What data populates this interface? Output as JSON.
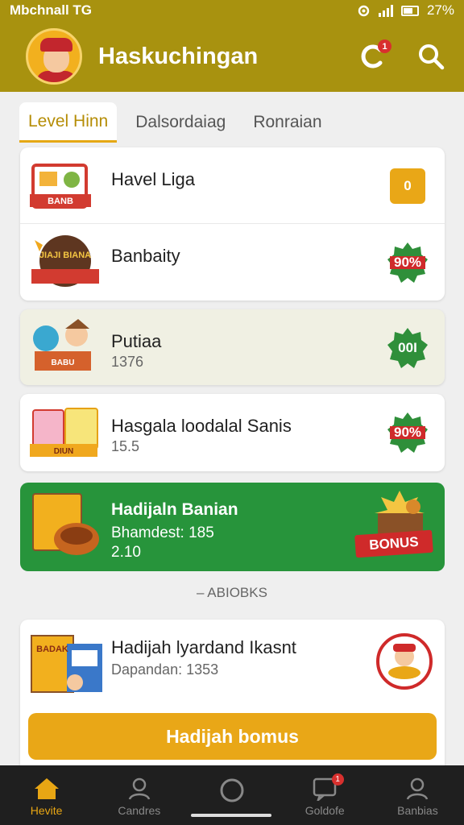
{
  "status_bar": {
    "left_text": "Mbchnall TG",
    "battery_text": "27%",
    "icons": [
      "settings-icon",
      "signal-icon",
      "battery-icon"
    ]
  },
  "header": {
    "title": "Haskuchingan",
    "icons": [
      "notification-icon",
      "search-icon"
    ],
    "notification_count": "1"
  },
  "tabs": [
    {
      "label": "Level Hinn"
    },
    {
      "label": "Dalsordaiag"
    },
    {
      "label": "Ronraian"
    }
  ],
  "cards": [
    {
      "title": "Havel Liga",
      "badge": "0",
      "thumb_text": "BANB"
    },
    {
      "title": "Banbaity",
      "badge": "90%",
      "thumb_text": "JIAJI BIANA"
    },
    {
      "title": "Putiaa",
      "subtitle": "1376",
      "badge": "00I",
      "thumb_text": "BABU"
    },
    {
      "title": "Hasgala loodalal Sanis",
      "subtitle": "15.5",
      "badge": "90%",
      "thumb_text": "DIUN"
    }
  ],
  "promo": {
    "title": "Hadijaln Banian",
    "subtitle1": "Bhamdest: 185",
    "subtitle2": "2.10",
    "ribbon": "BONUS"
  },
  "section_label": "– ABIOBKS",
  "bottom_card": {
    "title": "Hadijah lyardand Ikasnt",
    "subtitle": "Dapandan: 1353",
    "cta": "Hadijah bomus",
    "thumb_text": "BADAK"
  },
  "bottom_nav": [
    {
      "label": "Hevite",
      "icon": "home-icon"
    },
    {
      "label": "Candres",
      "icon": "user-icon"
    },
    {
      "label": "",
      "icon": "circle-icon"
    },
    {
      "label": "Goldofe",
      "icon": "chat-icon",
      "badge": "1"
    },
    {
      "label": "Banbias",
      "icon": "profile-icon"
    }
  ],
  "colors": {
    "header": "#a8920f",
    "accent": "#e9a717",
    "promo": "#27943b",
    "badge_red": "#cf2a2a",
    "badge_green": "#2f8f3a"
  }
}
